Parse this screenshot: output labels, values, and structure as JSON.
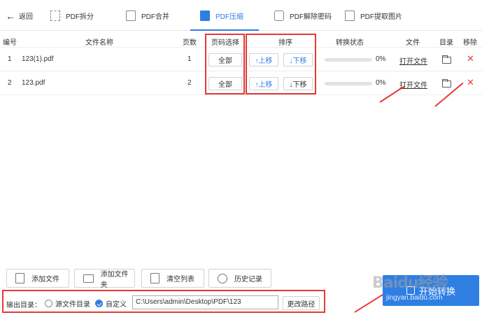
{
  "nav": {
    "back_label": "返回",
    "tabs": [
      {
        "label": "PDF拆分",
        "active": false
      },
      {
        "label": "PDF合并",
        "active": false
      },
      {
        "label": "PDF压缩",
        "active": true
      },
      {
        "label": "PDF解除密码",
        "active": false
      },
      {
        "label": "PDF提取图片",
        "active": false
      }
    ]
  },
  "table": {
    "columns": [
      "编号",
      "文件名称",
      "页数",
      "页码选择",
      "排序",
      "转换状态",
      "文件",
      "目录",
      "移除"
    ],
    "rows": [
      {
        "no": "1",
        "name": "123(1).pdf",
        "pages": "1",
        "page_select": "全部",
        "up": "↑上移",
        "down": "↓下移",
        "progress": "0%",
        "open": "打开文件"
      },
      {
        "no": "2",
        "name": "123.pdf",
        "pages": "2",
        "page_select": "全部",
        "up": "↑上移",
        "down": "↓下移",
        "progress": "0%",
        "open": "打开文件"
      }
    ]
  },
  "actions": {
    "add_file": "添加文件",
    "add_folder": "添加文件夹",
    "clear_list": "清空列表",
    "history": "历史记录"
  },
  "output": {
    "label": "输出目录：",
    "option_source": "源文件目录",
    "option_custom": "自定义",
    "path": "C:\\Users\\admin\\Desktop\\PDF\\123",
    "change_path": "更改路径"
  },
  "convert_button": "开始转换",
  "watermark": {
    "brand": "Baidu经验",
    "url": "jingyan.baidu.com"
  },
  "colors": {
    "accent": "#2f7fe3",
    "highlight": "#e53935",
    "remove": "#e03b3b"
  }
}
